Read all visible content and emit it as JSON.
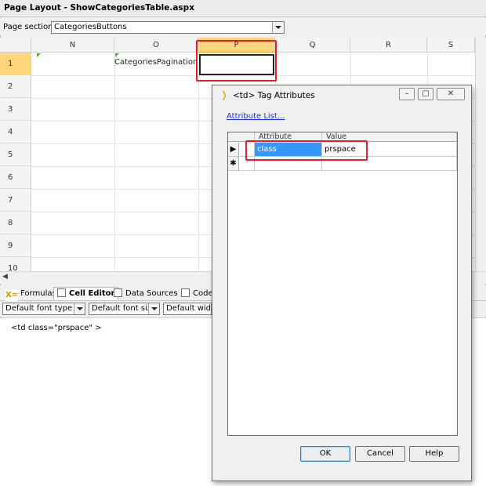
{
  "window": {
    "title": "Page Layout - ShowCategoriesTable.aspx",
    "page_section_label": "Page section:",
    "page_section_value": "CategoriesButtons"
  },
  "grid": {
    "columns": [
      "N",
      "O",
      "P",
      "Q",
      "R",
      "S"
    ],
    "selected_column": "P",
    "rows": [
      "1",
      "2",
      "3",
      "4",
      "5",
      "6",
      "7",
      "8",
      "9",
      "10"
    ],
    "cell_text": "CategoriesPagination"
  },
  "bottom_panel": {
    "tabs": [
      {
        "label": "Formulas",
        "icon": "formulas-icon"
      },
      {
        "label": "Cell Editor",
        "icon": "cell-editor-icon"
      },
      {
        "label": "Data Sources",
        "icon": "data-sources-icon"
      },
      {
        "label": "Code",
        "icon": "code-icon"
      }
    ],
    "active_tab": "Cell Editor",
    "font_type": "Default font type",
    "font_size": "Default font size",
    "width": "Default widtl",
    "editor_text": "<td class=\"prspace\" >"
  },
  "dialog": {
    "title": "<td> Tag Attributes",
    "link": "Attribute List...",
    "columns": [
      "Attribute",
      "Value"
    ],
    "rows": [
      {
        "marker": "▶",
        "attribute": "class",
        "value": "prspace"
      },
      {
        "marker": "✱",
        "attribute": "",
        "value": ""
      }
    ],
    "buttons": {
      "ok": "OK",
      "cancel": "Cancel",
      "help": "Help"
    }
  },
  "colors": {
    "highlight_red": "#e0212a",
    "selection_blue": "#3399ff",
    "header_selected": "#ffd67a",
    "link_blue": "#1a32d6"
  }
}
